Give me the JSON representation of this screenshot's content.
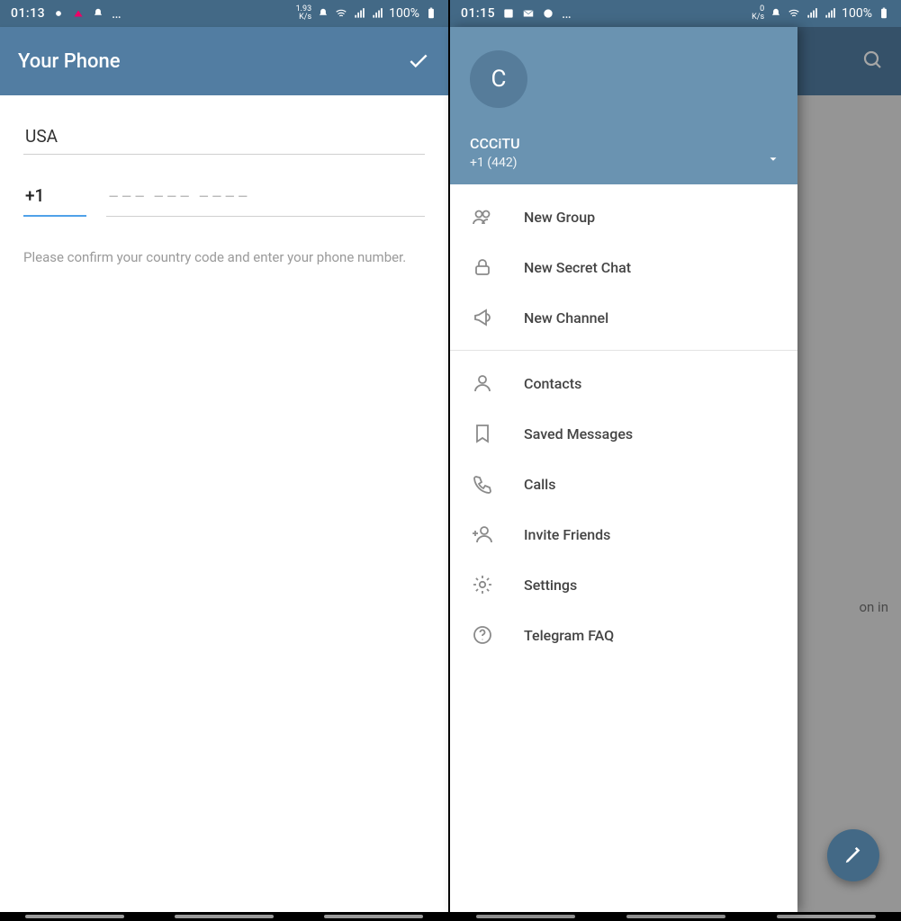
{
  "left": {
    "status": {
      "time": "01:13",
      "speed_top": "1.93",
      "speed_unit": "K/s",
      "battery": "100%"
    },
    "action": {
      "title": "Your Phone"
    },
    "country": "USA",
    "code": "+1",
    "num_placeholder": "––– ––– ––––",
    "hint": "Please confirm your country code and enter your phone number."
  },
  "right": {
    "status": {
      "time": "01:15",
      "speed_top": "0",
      "speed_unit": "K/s",
      "battery": "100%"
    },
    "drawer": {
      "avatar_initial": "C",
      "username": "CCCiTU",
      "phone": "+1 (442)",
      "items_a": [
        {
          "id": "new-group",
          "label": "New Group"
        },
        {
          "id": "secret-chat",
          "label": "New Secret Chat"
        },
        {
          "id": "new-channel",
          "label": "New Channel"
        }
      ],
      "items_b": [
        {
          "id": "contacts",
          "label": "Contacts"
        },
        {
          "id": "saved",
          "label": "Saved Messages"
        },
        {
          "id": "calls",
          "label": "Calls"
        },
        {
          "id": "invite",
          "label": "Invite Friends"
        },
        {
          "id": "settings",
          "label": "Settings"
        },
        {
          "id": "faq",
          "label": "Telegram FAQ"
        }
      ]
    },
    "fragment": "on in"
  },
  "icons": {
    "new-group": "<circle cx='8' cy='9' r='3.5'/><circle cx='16' cy='9' r='3.5'/><path d='M2 20c0-3 3-5 6-5s6 2 6 5'/><path d='M12 20c0-3 3-5 6-5'/>",
    "secret-chat": "<rect x='5' y='11' width='14' height='9' rx='2'/><path d='M8 11V8a4 4 0 0 1 8 0v3'/>",
    "new-channel": "<path d='M4 10v4l4 1 8 5V4l-8 5z'/><path d='M16 8a4 4 0 0 1 0 8'/>",
    "contacts": "<circle cx='12' cy='8' r='4'/><path d='M4 21c0-4 4-7 8-7s8 3 8 7'/>",
    "saved": "<path d='M6 3h12v18l-6-4-6 4z'/>",
    "calls": "<path d='M5 4l4 1 2 5-3 2a12 12 0 0 0 5 5l2-3 5 2 1 4a2 2 0 0 1-2 2A18 18 0 0 1 3 6a2 2 0 0 1 2-2z'/>",
    "invite": "<circle cx='14' cy='8' r='4'/><path d='M6 21c0-4 4-7 8-7s8 3 8 7'/><path d='M4 8v6M1 11h6'/>",
    "settings": "<circle cx='12' cy='12' r='3.2'/><path d='M12 2v3M12 19v3M2 12h3M19 12h3M4.9 4.9l2.1 2.1M17 17l2.1 2.1M4.9 19.1L7 17M17 7l2.1-2.1'/>",
    "faq": "<circle cx='12' cy='12' r='9'/><path d='M9.5 9a2.5 2.5 0 1 1 3.5 2.3c-.9.4-1 1-1 1.7'/><circle cx='12' cy='17' r='.6' fill='#8a8a8a' stroke='none'/>"
  }
}
